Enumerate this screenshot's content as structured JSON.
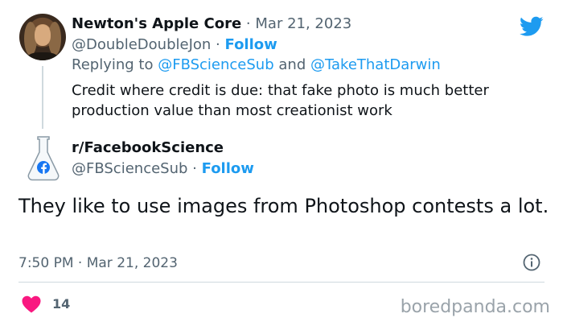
{
  "reply_tweet": {
    "author_name": "Newton's Apple Core",
    "separator": "·",
    "date": "Mar 21, 2023",
    "handle": "@DoubleDoubleJon",
    "follow_label": "Follow",
    "replying_prefix": "Replying to",
    "replying_to_1": "@FBScienceSub",
    "replying_and": "and",
    "replying_to_2": "@TakeThatDarwin",
    "text": "Credit where credit is due: that fake photo is much better production value than most creationist work"
  },
  "main_tweet": {
    "author_name": "r/FacebookScience",
    "handle": "@FBScienceSub",
    "separator": "·",
    "follow_label": "Follow",
    "text": "They like to use images from Photoshop contests a lot.",
    "time": "7:50 PM",
    "date": "Mar 21, 2023",
    "likes": "14"
  },
  "watermark": "boredpanda.com",
  "colors": {
    "accent": "#1d9bf0",
    "heart": "#f91880",
    "muted": "#536471",
    "text": "#0f1419"
  },
  "icons": [
    "twitter-bird-icon",
    "facebook-icon",
    "info-icon",
    "heart-icon"
  ]
}
